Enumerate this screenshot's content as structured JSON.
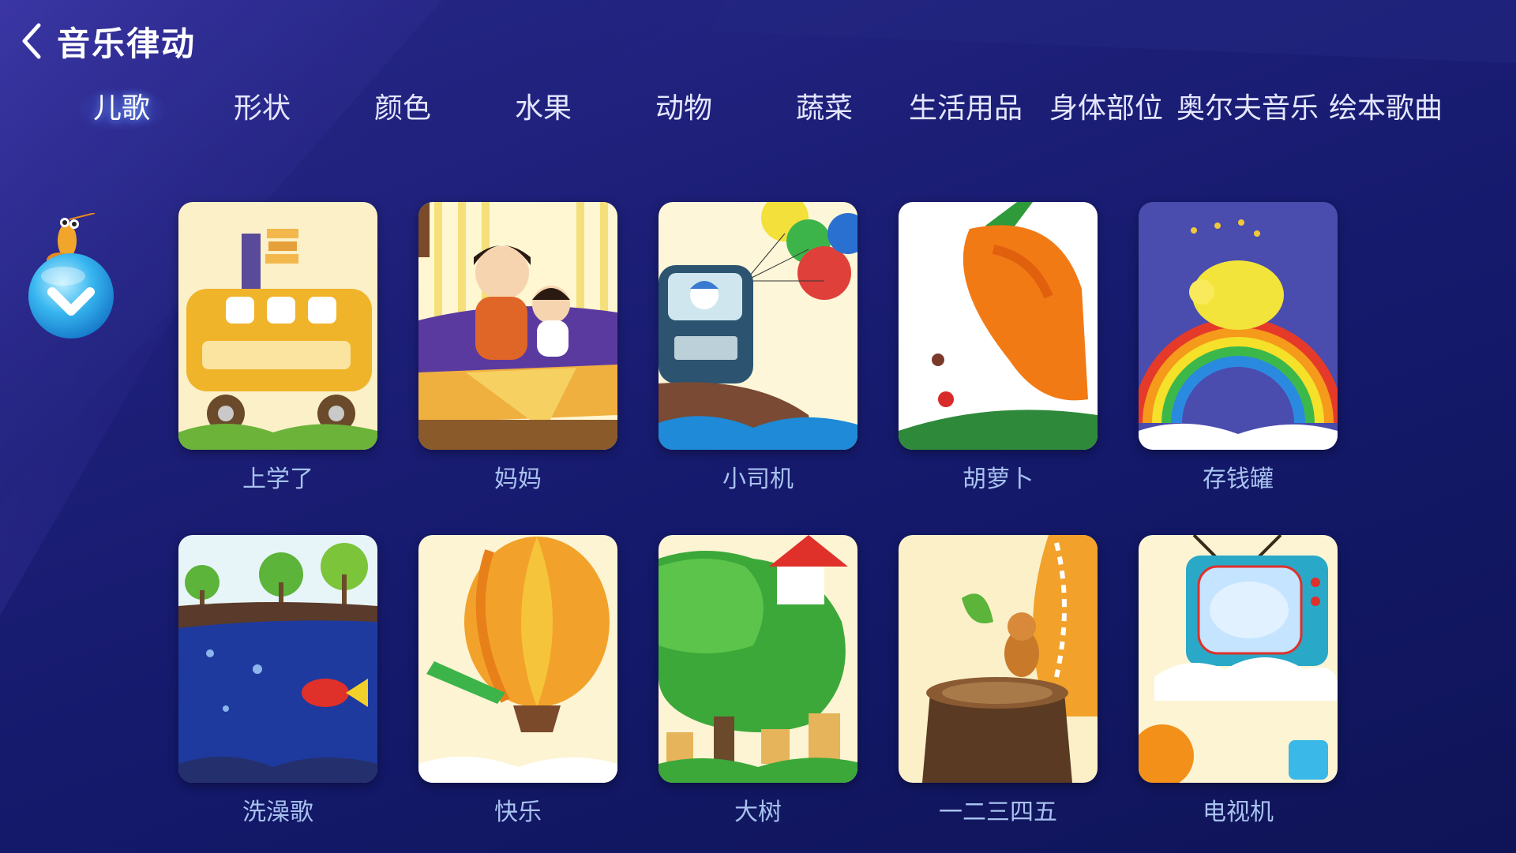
{
  "header": {
    "title": "音乐律动"
  },
  "tabs": [
    {
      "label": "儿歌",
      "active": true
    },
    {
      "label": "形状"
    },
    {
      "label": "颜色"
    },
    {
      "label": "水果"
    },
    {
      "label": "动物"
    },
    {
      "label": "蔬菜"
    },
    {
      "label": "生活用品"
    },
    {
      "label": "身体部位"
    },
    {
      "label": "奥尔夫音乐"
    },
    {
      "label": "绘本歌曲"
    }
  ],
  "songs": [
    {
      "title": "上学了",
      "art": "school-bus-icon"
    },
    {
      "title": "妈妈",
      "art": "mother-icon"
    },
    {
      "title": "小司机",
      "art": "car-icon"
    },
    {
      "title": "胡萝卜",
      "art": "carrot-icon"
    },
    {
      "title": "存钱罐",
      "art": "piggy-bank-icon"
    },
    {
      "title": "洗澡歌",
      "art": "fish-icon"
    },
    {
      "title": "快乐",
      "art": "balloon-icon"
    },
    {
      "title": "大树",
      "art": "tree-icon"
    },
    {
      "title": "一二三四五",
      "art": "squirrel-icon"
    },
    {
      "title": "电视机",
      "art": "tv-icon"
    }
  ],
  "colors": {
    "accent": "#5a8cff",
    "label": "#a8c2ef",
    "background": "#1d1f78"
  }
}
